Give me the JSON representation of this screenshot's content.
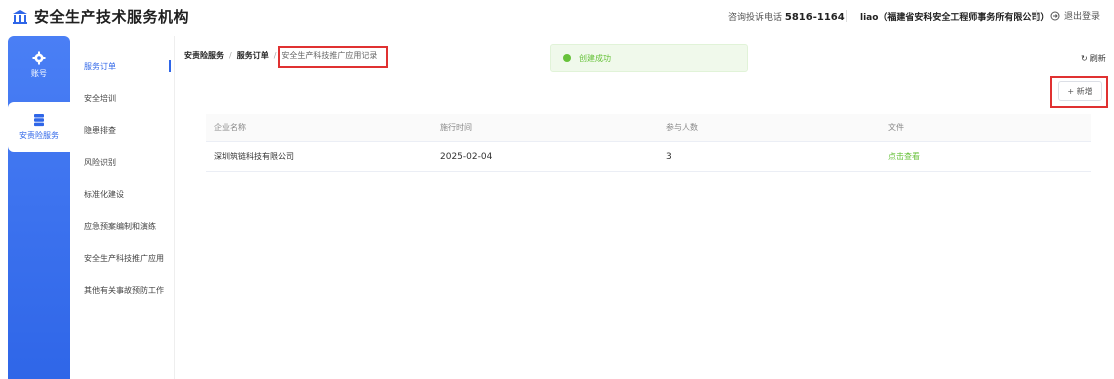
{
  "header": {
    "title": "安全生产技术服务机构",
    "hotline_label": "咨询投诉电话",
    "hotline_number": "5816-1164",
    "user": "liao（福建省安科安全工程师事务所有限公司）",
    "logout": "退出登录"
  },
  "rail": {
    "items": [
      {
        "label": "账号",
        "icon": "gear-icon"
      },
      {
        "label": "安责险服务",
        "icon": "database-icon"
      }
    ]
  },
  "submenu": {
    "items": [
      "服务订单",
      "安全培训",
      "隐患排查",
      "风险识别",
      "标准化建设",
      "应急预案编制和演练",
      "安全生产科技推广应用",
      "其他有关事故预防工作"
    ]
  },
  "breadcrumb": {
    "items": [
      "安责险服务",
      "服务订单",
      "安全生产科技推广应用记录"
    ]
  },
  "toast": {
    "text": "创建成功"
  },
  "toolbar": {
    "refresh": "刷新",
    "add": "+ 新增"
  },
  "table": {
    "headers": [
      "企业名称",
      "施行时间",
      "参与人数",
      "文件"
    ],
    "rows": [
      {
        "company": "深圳筑链科技有限公司",
        "date": "2025-02-04",
        "count": "3",
        "file": "点击查看"
      }
    ]
  },
  "colors": {
    "accent": "#2f66e8",
    "success": "#67c23a",
    "highlight": "#e03131"
  }
}
